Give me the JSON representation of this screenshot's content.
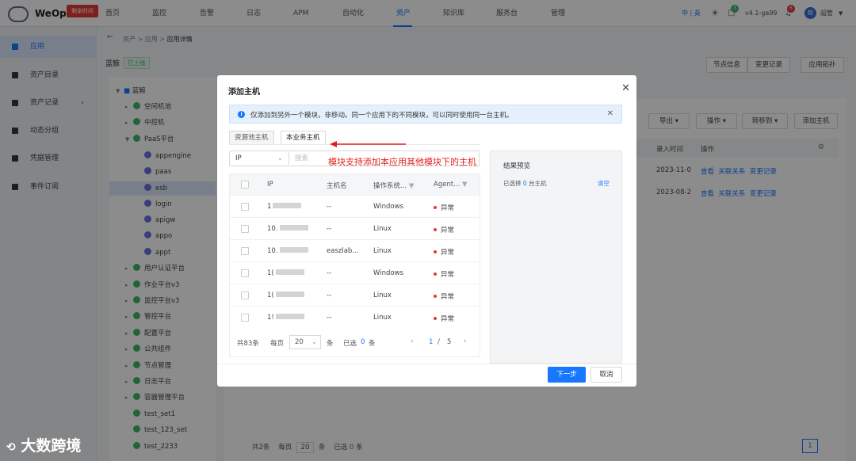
{
  "topbar": {
    "brand": "WeOps",
    "trial_badge": "剩余时间",
    "nav": [
      "首页",
      "监控",
      "告警",
      "日志",
      "APM",
      "自动化",
      "资产",
      "知识库",
      "服务台",
      "管理"
    ],
    "active_nav": "资产",
    "lang": "中 | 英",
    "version": "v4.1-ga99",
    "user": "超管",
    "user_avatar": "超",
    "notify_count": "6",
    "chat_count": "3"
  },
  "sidebar": {
    "items": [
      {
        "label": "应用",
        "active": true
      },
      {
        "label": "资产目录"
      },
      {
        "label": "资产记录"
      },
      {
        "label": "动态分组"
      },
      {
        "label": "凭据管理"
      },
      {
        "label": "事件订阅"
      }
    ]
  },
  "breadcrumb": {
    "items": [
      "资产",
      "应用",
      "应用详情"
    ]
  },
  "app_header": {
    "name": "蓝鲸",
    "status": "已上线",
    "tab_node_info": "节点信息",
    "tab_change_log": "变更记录",
    "topology_button": "应用拓扑"
  },
  "tree": {
    "root": "蓝鲸",
    "nodes": [
      "空闲机池",
      "中控机",
      "PaaS平台",
      "appengine",
      "paas",
      "esb",
      "login",
      "apigw",
      "appo",
      "appt",
      "用户认证平台",
      "作业平台v3",
      "监控平台v3",
      "管控平台",
      "配置平台",
      "公共组件",
      "节点管理",
      "日志平台",
      "容器管理平台",
      "test_set1",
      "test_123_set",
      "test_2233"
    ]
  },
  "bg_toolbar": {
    "export": "导出",
    "operate": "操作",
    "transfer": "转移到",
    "add_host": "添加主机"
  },
  "bg_table": {
    "col_time": "录入时间",
    "col_op": "操作",
    "rows": [
      {
        "time": "2023-11-0",
        "view": "查看",
        "rel": "关联关系",
        "log": "变更记录"
      },
      {
        "time": "2023-08-2",
        "view": "查看",
        "rel": "关联关系",
        "log": "变更记录"
      }
    ]
  },
  "bg_pager": {
    "total": "共2条",
    "per_page_label": "每页",
    "size": "20",
    "unit": "条",
    "selected_label": "已选",
    "selected": "0",
    "unit2": "条",
    "page": "1"
  },
  "modal": {
    "title": "添加主机",
    "info": "仅添加到另外一个模块，非移动。同一个应用下的不同模块，可以同时使用同一台主机。",
    "tabs": [
      "资源池主机",
      "本业务主机"
    ],
    "active_tab": 1,
    "filter_field": "IP",
    "search_placeholder": "搜索",
    "annotation": "模块支持添加本应用其他模块下的主机",
    "columns": [
      "IP",
      "主机名",
      "操作系统...",
      "Agent..."
    ],
    "rows": [
      {
        "ip": "1",
        "host": "--",
        "os": "Windows",
        "agent": "异常"
      },
      {
        "ip": "10.",
        "host": "--",
        "os": "Linux",
        "agent": "异常"
      },
      {
        "ip": "10.",
        "host": "easzlab...",
        "os": "Linux",
        "agent": "异常"
      },
      {
        "ip": "1(",
        "host": "--",
        "os": "Windows",
        "agent": "异常"
      },
      {
        "ip": "1(",
        "host": "--",
        "os": "Linux",
        "agent": "异常"
      },
      {
        "ip": "1!",
        "host": "--",
        "os": "Linux",
        "agent": "异常"
      }
    ],
    "pager": {
      "total": "共83条",
      "per_page_label": "每页",
      "size": "20",
      "unit": "条",
      "selected_label": "已选",
      "selected": "0",
      "unit2": "条",
      "current": "1",
      "sep": "/",
      "pages": "5"
    },
    "preview": {
      "title": "结果预览",
      "selected_prefix": "已选择",
      "selected_count": "0",
      "selected_suffix": "台主机",
      "clear": "清空"
    },
    "next_button": "下一步",
    "cancel_button": "取消"
  },
  "watermark": "大数跨境"
}
